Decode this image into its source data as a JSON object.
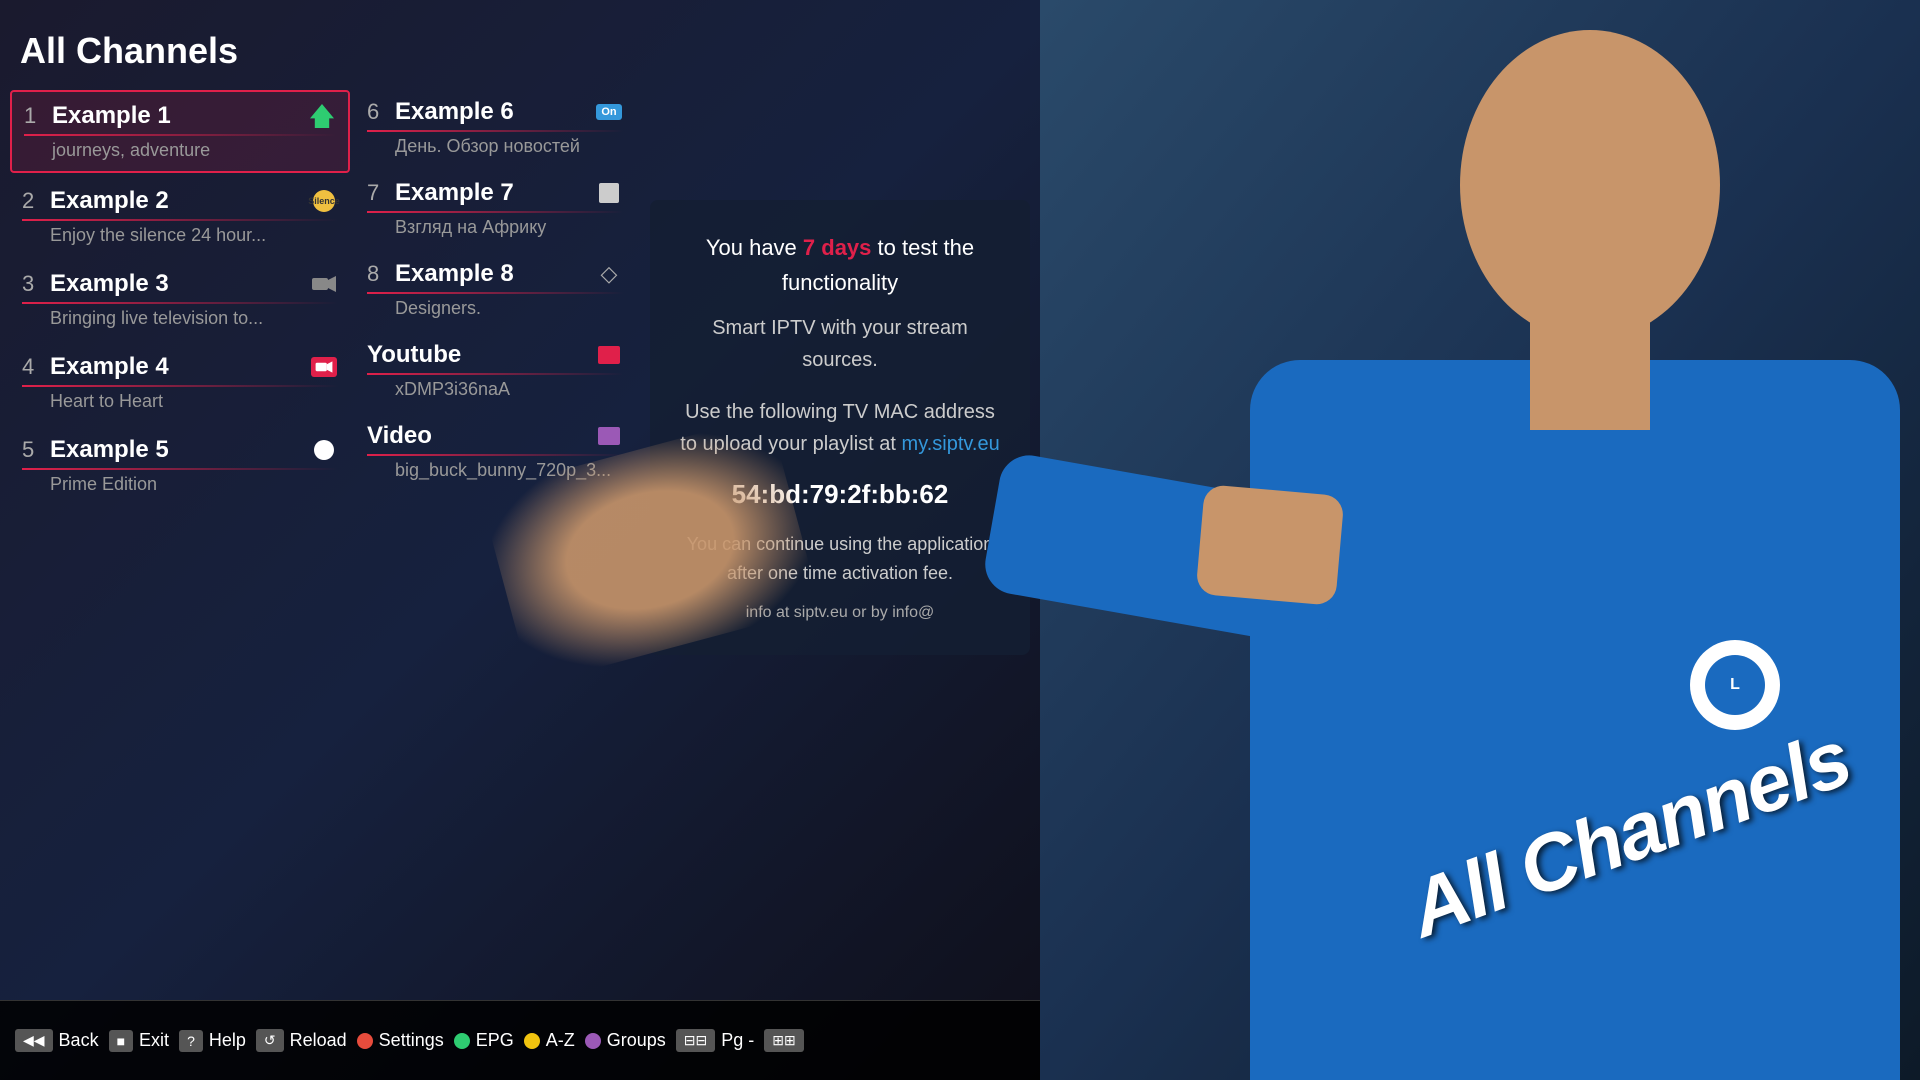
{
  "page": {
    "title": "All Channels",
    "background_color": "#111"
  },
  "left_column": {
    "channels": [
      {
        "number": "1",
        "name": "Example 1",
        "description": "journeys, adventure",
        "icon_type": "green-house",
        "selected": true
      },
      {
        "number": "2",
        "name": "Example 2",
        "description": "Enjoy the silence 24 hour...",
        "icon_type": "silence",
        "selected": false
      },
      {
        "number": "3",
        "name": "Example 3",
        "description": "Bringing live television to...",
        "icon_type": "camera",
        "selected": false
      },
      {
        "number": "4",
        "name": "Example 4",
        "description": "Heart to Heart",
        "icon_type": "camera-red",
        "selected": false
      },
      {
        "number": "5",
        "name": "Example 5",
        "description": "Prime Edition",
        "icon_type": "circle-white",
        "selected": false
      }
    ]
  },
  "right_column": {
    "channels": [
      {
        "number": "6",
        "name": "Example 6",
        "description": "День. Обзор новостей",
        "icon_type": "blue-badge",
        "selected": false
      },
      {
        "number": "7",
        "name": "Example 7",
        "description": "Взгляд на Африку",
        "icon_type": "white-square",
        "selected": false
      },
      {
        "number": "8",
        "name": "Example 8",
        "description": "Designers.",
        "icon_type": "diamond",
        "selected": false
      },
      {
        "number": "",
        "name": "Youtube",
        "description": "xDMP3i36naA",
        "icon_type": "red-box",
        "selected": false
      },
      {
        "number": "",
        "name": "Video",
        "description": "big_buck_bunny_720p_3...",
        "icon_type": "purple-box",
        "selected": false
      }
    ]
  },
  "info_panel": {
    "line1": "You have 7 days to test the functionality",
    "line1_highlight": "7 days",
    "line2": "Smart IPTV with your stream sources.",
    "line3": "Use the following TV MAC address",
    "line3b": "to upload your playlist at",
    "mac_link": "my.siptv.eu",
    "mac_address": "54:bd:79:2f:bb:62",
    "line4": "You can continue using the application",
    "line4b": "after one time activation fee.",
    "line5": "info at siptv.eu or by info@"
  },
  "toolbar": {
    "items": [
      {
        "btn": "gray",
        "label": "Back"
      },
      {
        "btn": "gray",
        "label": "Exit"
      },
      {
        "btn": "gray",
        "label": "Help"
      },
      {
        "btn": "gray",
        "label": "Reload"
      },
      {
        "btn": "red-dot",
        "label": "Settings"
      },
      {
        "btn": "green-dot",
        "label": "EPG"
      },
      {
        "btn": "yellow-dot",
        "label": "A-Z"
      },
      {
        "btn": "blue-dot",
        "label": "Groups"
      },
      {
        "btn": "gray",
        "label": "Pg -"
      },
      {
        "btn": "gray",
        "label": ""
      }
    ]
  },
  "icons": {
    "green_house": "⌂",
    "silence_label": "Silence",
    "camera": "📷",
    "circle": "●",
    "diamond": "◇",
    "red_square": "■",
    "purple_square": "■",
    "blue_badge_text": "On",
    "white_square": "■"
  }
}
